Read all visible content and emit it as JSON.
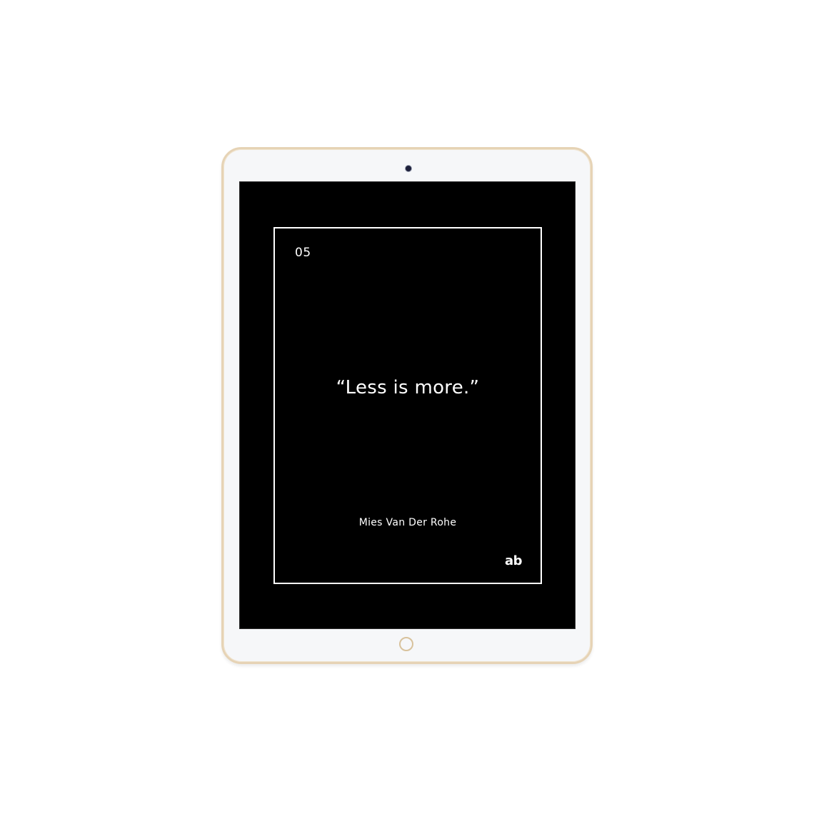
{
  "device": {
    "frame_color": "#e6d3b5",
    "screen_color": "#000000"
  },
  "card": {
    "number": "05",
    "quote": "“Less is more.”",
    "author": "Mies Van Der Rohe",
    "logo": "ab"
  }
}
